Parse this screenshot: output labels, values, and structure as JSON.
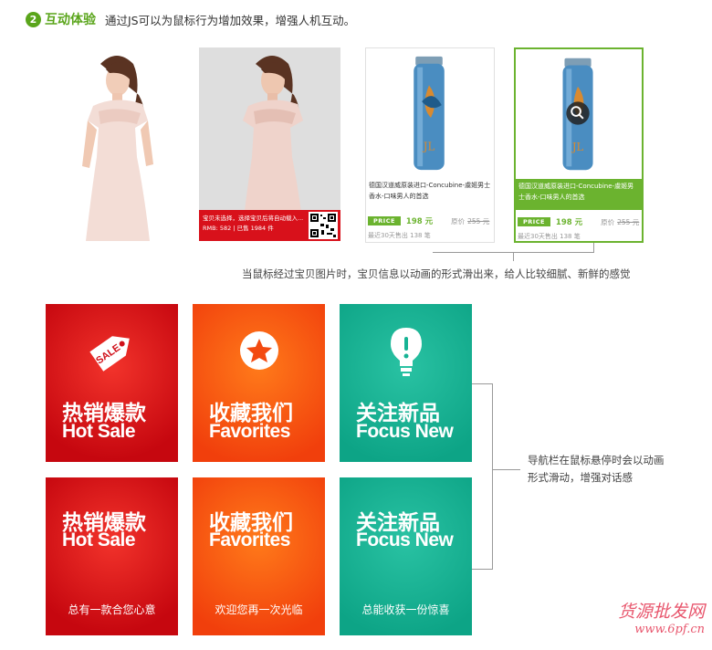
{
  "header": {
    "number": "2",
    "title": "互动体验",
    "description": "通过JS可以为鼠标行为增加效果，增强人机互动。"
  },
  "hover_card": {
    "overlay_line1": "宝贝未选择，选择宝贝后将自动载入...",
    "overlay_line2": "RMB: 582 | 已售 1984 件"
  },
  "products": [
    {
      "title": "德国汉道威原装进口-Concubine-虞姬男士香水-口味男人的首选",
      "price_tag": "PRICE",
      "price": "198 元",
      "orig_label": "原价",
      "orig_price": "255 元",
      "sold": "最近30天售出 138 笔"
    },
    {
      "title": "德国汉道威原装进口-Concubine-虞姬男士香水-口味男人的首选",
      "price_tag": "PRICE",
      "price": "198 元",
      "orig_label": "原价",
      "orig_price": "255 元",
      "sold": "最近30天售出 138 笔"
    }
  ],
  "note_top": "当鼠标经过宝贝图片时，宝贝信息以动画的形式滑出来，给人比较细腻、新鲜的感觉",
  "tiles_top": [
    {
      "cn": "热销爆款",
      "en": "Hot Sale",
      "icon": "sale-tag-icon",
      "color": "#d0101a"
    },
    {
      "cn": "收藏我们",
      "en": "Favorites",
      "icon": "star-icon",
      "color": "#f34a10"
    },
    {
      "cn": "关注新品",
      "en": "Focus New",
      "icon": "lightbulb-icon",
      "color": "#16b394"
    }
  ],
  "tiles_bottom": [
    {
      "cn": "热销爆款",
      "en": "Hot Sale",
      "sub": "总有一款合您心意",
      "color": "#d0101a"
    },
    {
      "cn": "收藏我们",
      "en": "Favorites",
      "sub": "欢迎您再一次光临",
      "color": "#f34a10"
    },
    {
      "cn": "关注新品",
      "en": "Focus New",
      "sub": "总能收获一份惊喜",
      "color": "#16b394"
    }
  ],
  "note_bottom": {
    "line1": "导航栏在鼠标悬停时会以动画",
    "line2": "形式滑动，增强对话感"
  },
  "watermark": {
    "line1": "货源批发网",
    "line2": "www.6pf.cn"
  }
}
